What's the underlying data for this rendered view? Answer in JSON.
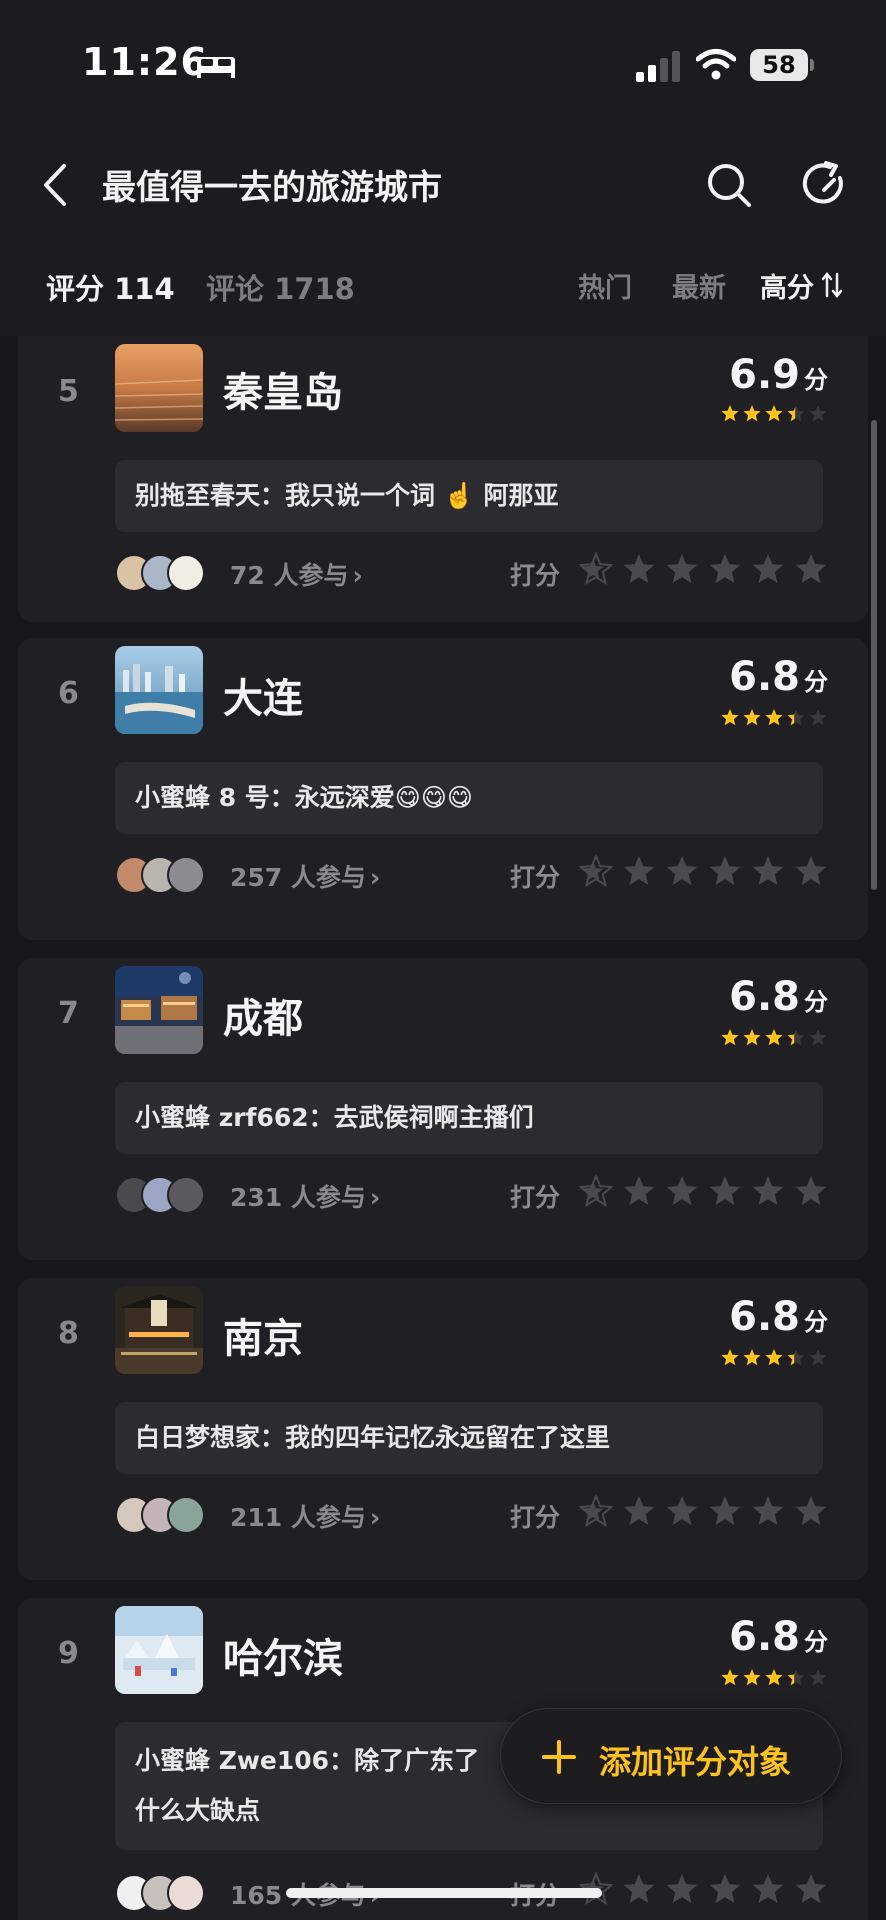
{
  "status_bar": {
    "time": "11:26",
    "battery": "58"
  },
  "header": {
    "title": "最值得一去的旅游城市"
  },
  "tabs": {
    "rating": "评分 114",
    "comments": "评论 1718",
    "sort_hot": "热门",
    "sort_new": "最新",
    "sort_high": "高分"
  },
  "rate_label": "打分",
  "colors": {
    "accent": "#ffc21a",
    "background": "#17171a",
    "card": "#202024"
  },
  "items": [
    {
      "rank": "5",
      "name": "秦皇岛",
      "score": "6.9",
      "unit": "分",
      "score_value": 6.9,
      "comment": "别拖至春天：我只说一个词 ☝️ 阿那亚",
      "participants": "72 人参与",
      "chevron": "›"
    },
    {
      "rank": "6",
      "name": "大连",
      "score": "6.8",
      "unit": "分",
      "score_value": 6.8,
      "comment": "小蜜蜂 8 号：永远深爱😋😋😋",
      "participants": "257 人参与",
      "chevron": "›"
    },
    {
      "rank": "7",
      "name": "成都",
      "score": "6.8",
      "unit": "分",
      "score_value": 6.8,
      "comment": "小蜜蜂 zrf662：去武侯祠啊主播们",
      "participants": "231 人参与",
      "chevron": "›"
    },
    {
      "rank": "8",
      "name": "南京",
      "score": "6.8",
      "unit": "分",
      "score_value": 6.8,
      "comment": "白日梦想家：我的四年记忆永远留在了这里",
      "participants": "211 人参与",
      "chevron": "›"
    },
    {
      "rank": "9",
      "name": "哈尔滨",
      "score": "6.8",
      "unit": "分",
      "score_value": 6.8,
      "comment": "小蜜蜂 Zwe106：除了广东了",
      "comment_line2": "什么大缺点",
      "participants": "165 人参与",
      "chevron": "›"
    }
  ],
  "fab": {
    "plus": "+",
    "label": "添加评分对象"
  }
}
